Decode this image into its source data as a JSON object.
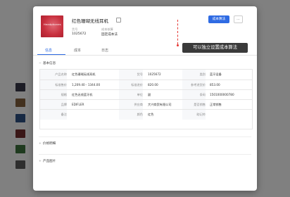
{
  "colors": {
    "accent": "#2f6be3",
    "cover": "#c8303e",
    "tooltip_bg": "#3a3a3a",
    "marker": "#e53935"
  },
  "product": {
    "title": "红色珊瑚无线耳机",
    "cover_text": "Headphones",
    "meta": [
      {
        "label": "货号",
        "value": "1025672"
      },
      {
        "label": "成本核算",
        "value": "固定成本法"
      }
    ]
  },
  "actions": {
    "primary": "成本算法",
    "more": "···"
  },
  "tabs": [
    "信息",
    "成本",
    "日志"
  ],
  "sections": {
    "basic": "基本信息",
    "price": "价格明细",
    "images": "产品图片"
  },
  "basic_info": [
    [
      {
        "label": "产品名称",
        "value": "红色珊瑚无线耳机"
      },
      {
        "label": "货号",
        "value": "1025672"
      },
      {
        "label": "类别",
        "value": "蓝牙设备"
      }
    ],
    [
      {
        "label": "标准售价",
        "value": "1,209.40 - 1344.00"
      },
      {
        "label": "标准进价",
        "value": "820.00"
      },
      {
        "label": "参考进货价",
        "value": "853.00"
      }
    ],
    [
      {
        "label": "规格",
        "value": "红色无线蓝牙机"
      },
      {
        "label": "单位",
        "value": "副"
      },
      {
        "label": "条码",
        "value": "1501000000780"
      }
    ],
    [
      {
        "label": "品牌",
        "value": "EDIFLER"
      },
      {
        "label": "供应商",
        "value": "大兴商贸有限公司"
      },
      {
        "label": "是否销售",
        "value": "正常销售"
      }
    ],
    [
      {
        "label": "备注",
        "value": ""
      },
      {
        "label": "颜色",
        "value": "红色"
      },
      {
        "label": "助记符",
        "value": ""
      }
    ]
  ],
  "tooltip": "可以独立设置成本算法"
}
